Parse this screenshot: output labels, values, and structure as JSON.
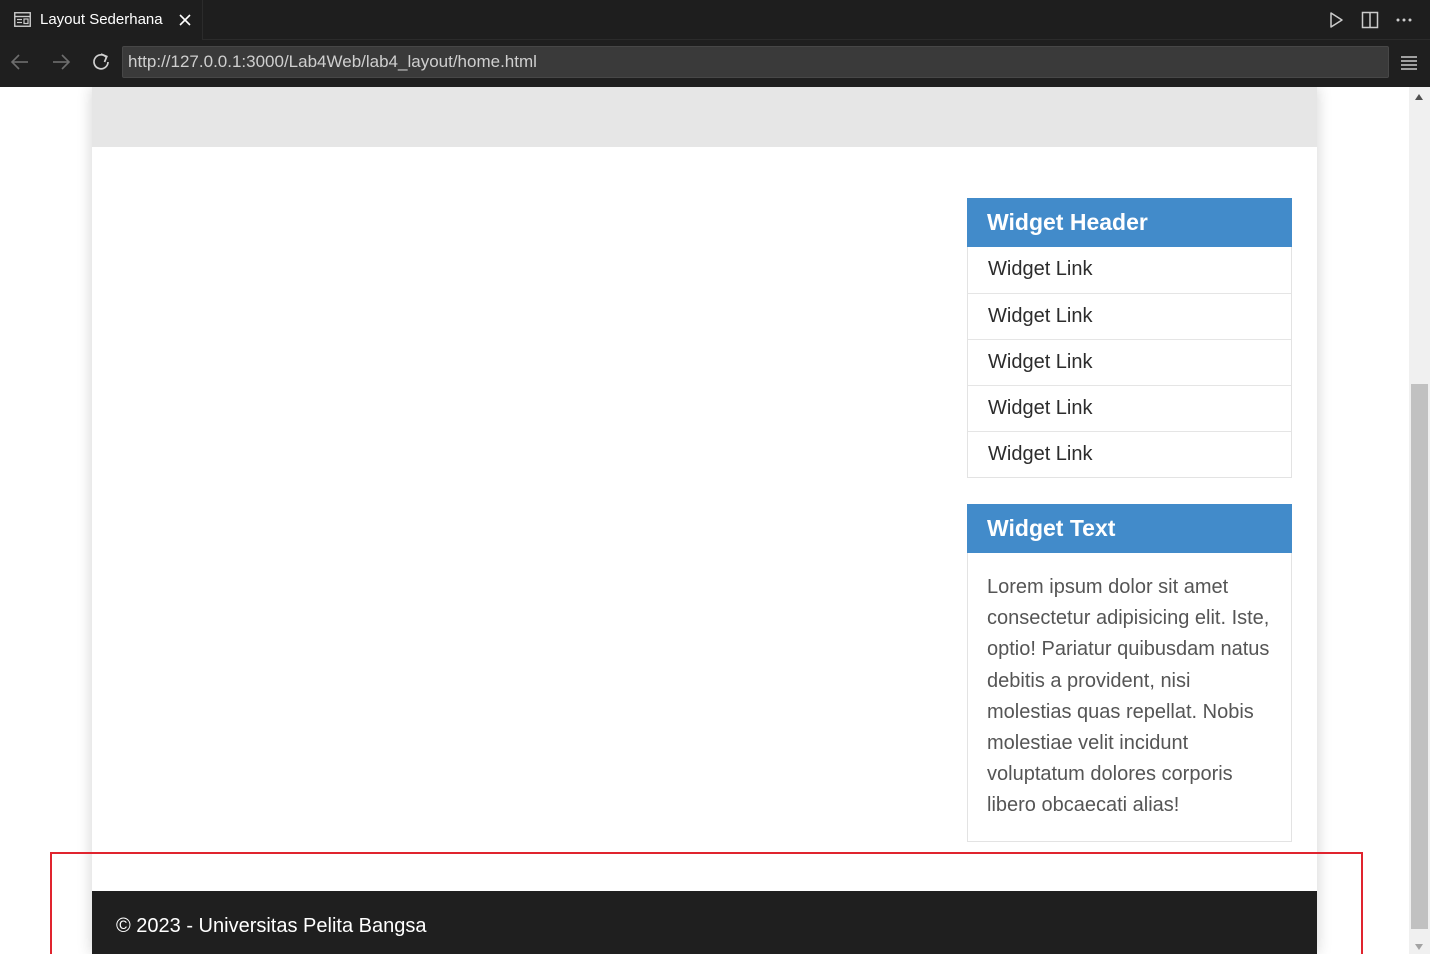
{
  "browser": {
    "tab_title": "Layout Sederhana",
    "url": "http://127.0.0.1:3000/Lab4Web/lab4_layout/home.html",
    "icons": {
      "tab": "layout-icon",
      "close": "close-icon",
      "run": "play-icon",
      "split": "split-editor-icon",
      "more": "more-icon",
      "back": "arrow-left-icon",
      "forward": "arrow-right-icon",
      "reload": "reload-icon",
      "menu": "hamburger-menu-icon"
    }
  },
  "sidebar": {
    "widget_links": {
      "header": "Widget Header",
      "links": [
        "Widget Link",
        "Widget Link",
        "Widget Link",
        "Widget Link",
        "Widget Link"
      ]
    },
    "widget_text": {
      "header": "Widget Text",
      "body": "Lorem ipsum dolor sit amet consectetur adipisicing elit. Iste, optio! Pariatur quibusdam natus debitis a provident, nisi molestias quas repellat. Nobis molestiae velit incidunt voluptatum dolores corporis libero obcaecati alias!"
    }
  },
  "footer": {
    "text": "© 2023 - Universitas Pelita Bangsa"
  },
  "colors": {
    "widget_header_bg": "#428bca",
    "footer_bg": "#1f1f1f",
    "highlight_border": "#e0242e"
  }
}
